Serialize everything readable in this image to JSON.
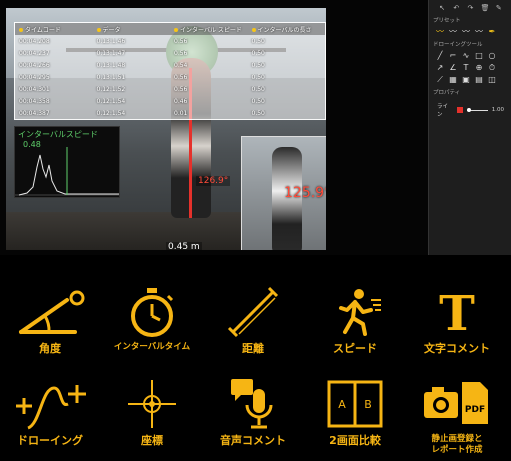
{
  "video": {
    "table": {
      "headers": [
        "タイムコード",
        "データ",
        "インターバル スピード",
        "インターバルの長さ"
      ],
      "rows": [
        [
          "00:04.208",
          "0.13:1.46",
          "0.56",
          "0.50"
        ],
        [
          "00:04.237",
          "0.13:1.47",
          "0.56",
          "0.50"
        ],
        [
          "00:04.266",
          "0.13:1.48",
          "0.54",
          "0.50"
        ],
        [
          "00:04.295",
          "0.13:1.51",
          "0.56",
          "0.50"
        ],
        [
          "00:04.301",
          "0.12:1.52",
          "0.56",
          "0.50"
        ],
        [
          "00:04.358",
          "0.12:1.54",
          "0.46",
          "0.50"
        ],
        [
          "00:04.387",
          "0.12:1.54",
          "0.01",
          "0.50"
        ]
      ]
    },
    "speed_graph": {
      "label": "インターバルスピード",
      "value": "0.48"
    },
    "angle_large": "125.9°",
    "angle_small": "126.9°",
    "distance": "0.45 m"
  },
  "panel": {
    "section_preset": "プリセット",
    "section_tools": "ドローイングツール",
    "section_props": "プロパティ",
    "line_label": "ライン",
    "line_value": "1.00",
    "line_color": "#e5312b"
  },
  "features": [
    {
      "label": "角度",
      "icon": "angle-icon"
    },
    {
      "label": "インターバルタイム",
      "icon": "stopwatch-icon"
    },
    {
      "label": "距離",
      "icon": "distance-icon"
    },
    {
      "label": "スピード",
      "icon": "runner-icon"
    },
    {
      "label": "文字コメント",
      "icon": "text-icon"
    },
    {
      "label": "ドローイング",
      "icon": "drawing-icon"
    },
    {
      "label": "座標",
      "icon": "crosshair-icon"
    },
    {
      "label": "音声コメント",
      "icon": "microphone-icon"
    },
    {
      "label": "2画面比較",
      "icon": "split-screen-icon"
    },
    {
      "label": "静止画登録と\nレポート作成",
      "icon": "camera-pdf-icon"
    }
  ],
  "colors": {
    "accent": "#f6b514",
    "graph": "#5fd06b",
    "angle": "#ff4b3a"
  }
}
